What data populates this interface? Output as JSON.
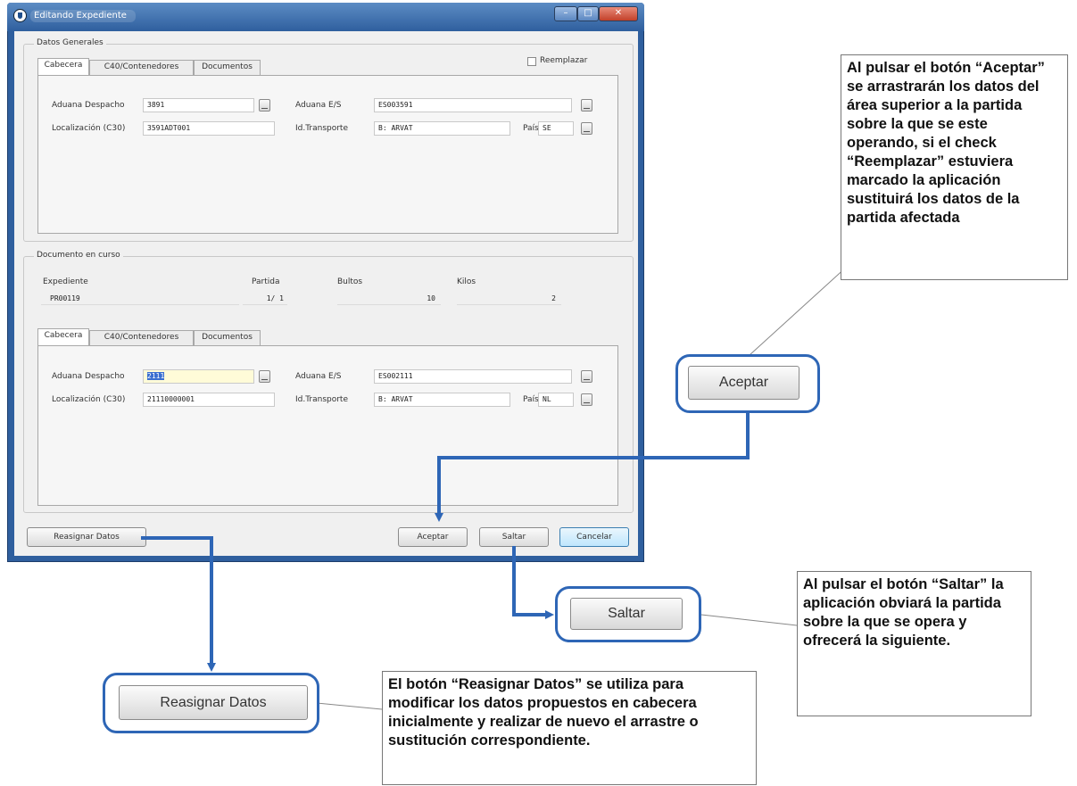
{
  "window": {
    "title": "Editando Expediente",
    "buttons": {
      "minimize": "–",
      "maximize": "□",
      "close": "✕"
    }
  },
  "datos_generales": {
    "label": "Datos Generales",
    "reemplazar_label": "Reemplazar",
    "tabs": [
      "Cabecera",
      "C40/Contenedores",
      "Documentos"
    ],
    "fields": {
      "aduana_despacho_label": "Aduana Despacho",
      "aduana_despacho_value": "3891",
      "aduana_es_label": "Aduana E/S",
      "aduana_es_value": "ES003591",
      "localizacion_label": "Localización (C30)",
      "localizacion_value": "3591ADT001",
      "id_transporte_label": "Id.Transporte",
      "id_transporte_value": "B: ARVAT",
      "pais_label": "País",
      "pais_value": "SE"
    }
  },
  "documento_en_curso": {
    "label": "Documento en curso",
    "headers": {
      "expediente": "Expediente",
      "partida": "Partida",
      "bultos": "Bultos",
      "kilos": "Kilos"
    },
    "values": {
      "expediente": "PR00119",
      "partida": "1/ 1",
      "bultos": "10",
      "kilos": "2"
    },
    "tabs": [
      "Cabecera",
      "C40/Contenedores",
      "Documentos"
    ],
    "fields": {
      "aduana_despacho_label": "Aduana Despacho",
      "aduana_despacho_value": "2111",
      "aduana_es_label": "Aduana E/S",
      "aduana_es_value": "ES002111",
      "localizacion_label": "Localización (C30)",
      "localizacion_value": "21110000001",
      "id_transporte_label": "Id.Transporte",
      "id_transporte_value": "B: ARVAT",
      "pais_label": "País",
      "pais_value": "NL"
    }
  },
  "footer_buttons": {
    "reasignar": "Reasignar Datos",
    "aceptar": "Aceptar",
    "saltar": "Saltar",
    "cancelar": "Cancelar"
  },
  "annotations": {
    "aceptar_button": "Aceptar",
    "saltar_button": "Saltar",
    "reasignar_button": "Reasignar Datos",
    "aceptar_note": "Al pulsar el botón “Aceptar” se arrastrarán los datos del área superior a la partida sobre la que se este operando, si el check “Reemplazar” estuviera marcado la aplicación sustituirá los datos de la partida afectada",
    "saltar_note": "Al pulsar el botón “Saltar” la aplicación obviará la partida sobre la que se opera y ofrecerá la siguiente.",
    "reasignar_note": "El botón “Reasignar Datos” se utiliza para modificar los datos propuestos en cabecera inicialmente y realizar de nuevo el arrastre o sustitución correspondiente."
  },
  "colors": {
    "window_frame": "#2f5f9e",
    "callout_border": "#2e66b6",
    "selection": "#3a6fd0",
    "highlight_field": "#fffbd8"
  }
}
